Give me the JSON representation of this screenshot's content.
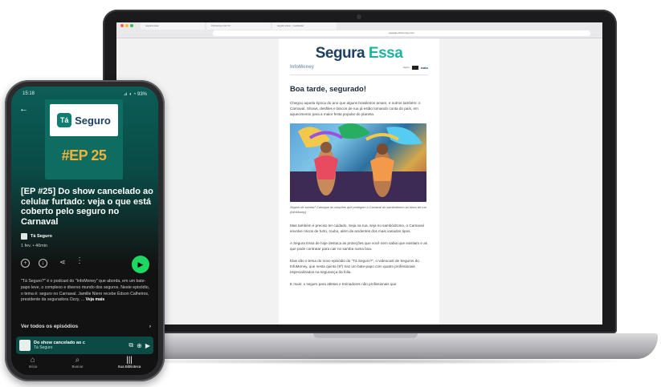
{
  "browser": {
    "tabs": [
      "segura essa",
      "infomoney.com.br",
      "segura essa – newsletter"
    ],
    "url": "segurae.infomoney.com"
  },
  "newsletter": {
    "brand_part1": "Segura ",
    "brand_part2": "Essa",
    "publisher": "InfoMoney",
    "partners_label": "Apoio",
    "partner_text": "icatu",
    "greeting": "Boa tarde, segurado!",
    "paragraph_1": "Chegou aquela época do ano que alguns brasileiros amam, e outros também: o Carnaval. Shows, desfiles e blocos de rua já estão tomando conta do país, em aquecimento para a maior festa popular do planeta.",
    "photo_caption": "Seguro de samba? Carregue as soluções que protegem o Carnaval do sambódromo ao bloco de rua (InfoMoney)",
    "paragraph_2": "Mas também é preciso ter cuidado. Seja na rua, seja no sambódromo, o Carnaval envolve riscos de furto, roubo, além de acidentes dos mais variados tipos.",
    "paragraph_3": "A Segura Essa de hoje destaca as proteções que você nem sabia que existiam e as que pode contratar para cair no samba numa boa.",
    "paragraph_4": "Elas são o tema do novo episódio do \"Tá Seguro?\", o videocast de Seguros do InfoMoney, que nesta quinta (9º) traz um bate-papo com quatro profissionais especializados na segurança da folia.",
    "paragraph_5": "E mais: o seguro para atletas e treinadores não profissionais que"
  },
  "phone": {
    "status_time": "15:18",
    "status_right": "⊿ ◖ ◔ 93%",
    "cover_logo_mark": "Tá",
    "cover_logo_text": "Seguro",
    "cover_episode": "#EP 25",
    "episode_title": "[EP #25] Do show cancelado ao celular furtado: veja o que está coberto pelo seguro no Carnaval",
    "show_name": "Tá Seguro",
    "meta": "1 fev. • 46min",
    "description": "\"Tá Seguro?\" é o podcast do \"InfoMoney\" que aborda, em um bate-papo leve, o complexo e diverso mundo dos seguros. Neste episódio, o tema é: seguro no Carnaval. Jamille Niero recebe Édson Calheiros, presidente da seguradora Ozzy, ...",
    "description_more": "Veja mais",
    "all_episodes": "Ver todos os episódios",
    "mini_player": {
      "title": "Do show cancelado ao c",
      "subtitle": "Tá Seguro"
    },
    "nav": [
      {
        "label": "Início",
        "icon": "home-icon"
      },
      {
        "label": "Buscar",
        "icon": "search-icon"
      },
      {
        "label": "Sua Biblioteca",
        "icon": "library-icon"
      }
    ],
    "colors": {
      "play": "#1ed760",
      "cover_bg": "#0f6c61",
      "episode_accent": "#f3b23a"
    }
  }
}
